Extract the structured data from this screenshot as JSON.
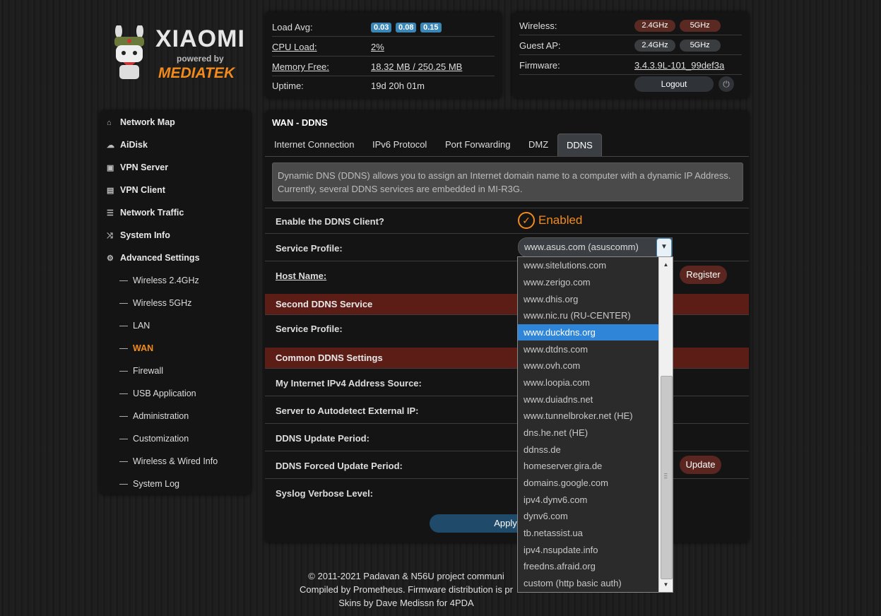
{
  "logo": {
    "brand": "XIAOMI",
    "powered": "powered by",
    "chip": "MEDIATEK"
  },
  "status": {
    "load_avg_label": "Load Avg:",
    "load_avg": [
      "0.03",
      "0.08",
      "0.15"
    ],
    "cpu_label": "CPU Load:",
    "cpu_value": "2%",
    "mem_label": "Memory Free:",
    "mem_value": "18.32 MB / 250.25 MB",
    "uptime_label": "Uptime:",
    "uptime_value": "19d 20h 01m"
  },
  "system": {
    "wireless_label": "Wireless:",
    "guest_label": "Guest AP:",
    "band_24": "2.4GHz",
    "band_5": "5GHz",
    "firmware_label": "Firmware:",
    "firmware_value": "3.4.3.9L-101_99def3a",
    "logout": "Logout"
  },
  "sidebar": {
    "main": [
      "Network Map",
      "AiDisk",
      "VPN Server",
      "VPN Client",
      "Network Traffic",
      "System Info",
      "Advanced Settings"
    ],
    "sub": [
      "Wireless 2.4GHz",
      "Wireless 5GHz",
      "LAN",
      "WAN",
      "Firewall",
      "USB Application",
      "Administration",
      "Customization",
      "Wireless & Wired Info",
      "System Log"
    ],
    "active_sub": "WAN"
  },
  "main": {
    "title": "WAN - DDNS",
    "tabs": [
      "Internet Connection",
      "IPv6 Protocol",
      "Port Forwarding",
      "DMZ",
      "DDNS"
    ],
    "active_tab": "DDNS",
    "info": "Dynamic DNS (DDNS) allows you to assign an Internet domain name to a computer with a dynamic IP Address. Currently, several DDNS services are embedded in MI-R3G.",
    "enable_label": "Enable the DDNS Client?",
    "enabled_text": "Enabled",
    "service_profile_label": "Service Profile:",
    "service_profile_value": "www.asus.com (asuscomm)",
    "host_name_label": "Host Name:",
    "register": "Register",
    "second_section": "Second DDNS Service",
    "second_profile_label": "Service Profile:",
    "common_section": "Common DDNS Settings",
    "ipv4_source_label": "My Internet IPv4 Address Source:",
    "autodetect_label": "Server to Autodetect External IP:",
    "update_period_label": "DDNS Update Period:",
    "forced_period_label": "DDNS Forced Update Period:",
    "update": "Update",
    "syslog_label": "Syslog Verbose Level:",
    "apply": "Apply"
  },
  "dropdown": {
    "options": [
      "www.sitelutions.com",
      "www.zerigo.com",
      "www.dhis.org",
      "www.nic.ru (RU-CENTER)",
      "www.duckdns.org",
      "www.dtdns.com",
      "www.ovh.com",
      "www.loopia.com",
      "www.duiadns.net",
      "www.tunnelbroker.net (HE)",
      "dns.he.net (HE)",
      "ddnss.de",
      "homeserver.gira.de",
      "domains.google.com",
      "ipv4.dynv6.com",
      "dynv6.com",
      "tb.netassist.ua",
      "ipv4.nsupdate.info",
      "freedns.afraid.org",
      "custom (http basic auth)"
    ],
    "highlighted": "www.duckdns.org"
  },
  "footer": {
    "line1": "© 2011-2021 Padavan & N56U project communi",
    "line2": "Compiled by Prometheus. Firmware distribution is pr",
    "line3": "Skins by Dave Medissn for 4PDA"
  },
  "colors": {
    "accent": "#f38a1c",
    "badge": "#3a86b6",
    "section": "#5c1d17",
    "highlight": "#2f86d8"
  }
}
